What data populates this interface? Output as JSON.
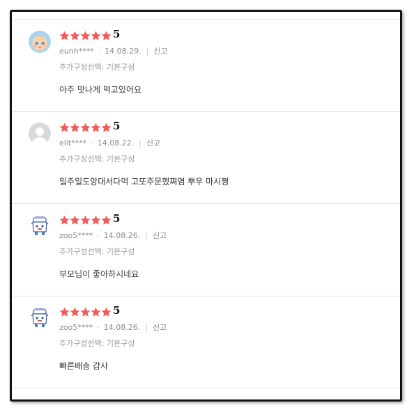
{
  "colors": {
    "star": "#f25a5a",
    "frame": "#111111",
    "divider": "#e4e4e4"
  },
  "reviews": [
    {
      "avatar_icon": "baby-face-avatar-icon",
      "rating": 5,
      "score": "5",
      "user": "eunh****",
      "date": "14.08.29.",
      "report": "신고",
      "option": "추가구성선택: 기본구성",
      "content": "아주 맛나게 먹고있어요"
    },
    {
      "avatar_icon": "default-user-avatar-icon",
      "rating": 5,
      "score": "5",
      "user": "elit****",
      "date": "14.08.22.",
      "report": "신고",
      "option": "추가구성선택: 기본구성",
      "content": "일주일도앙대서다먹 고또주문했쪄염 뿌우 마시쪙"
    },
    {
      "avatar_icon": "robot-character-avatar-icon",
      "rating": 5,
      "score": "5",
      "user": "zoo5****",
      "date": "14.08.26.",
      "report": "신고",
      "option": "추가구성선택: 기본구성",
      "content": "부모님이 좋아하시네요"
    },
    {
      "avatar_icon": "robot-character-avatar-icon",
      "rating": 5,
      "score": "5",
      "user": "zoo5****",
      "date": "14.08.26.",
      "report": "신고",
      "option": "추가구성선택: 기본구성",
      "content": "빠른배송 감사"
    }
  ]
}
